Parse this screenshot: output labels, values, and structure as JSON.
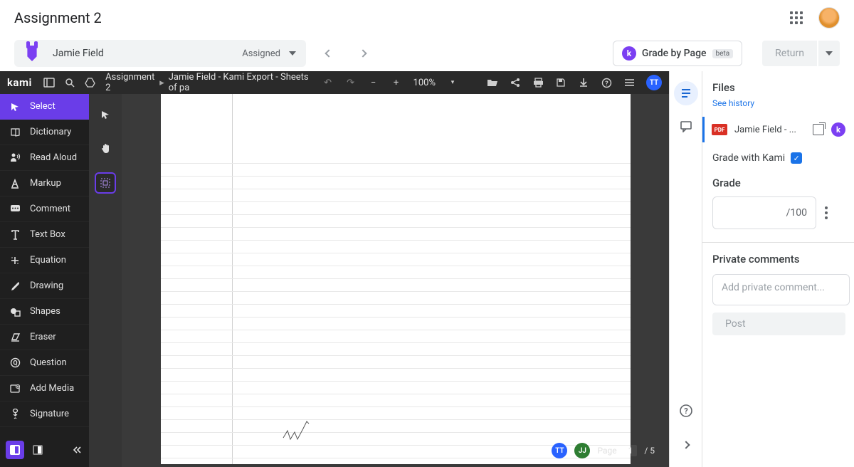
{
  "header": {
    "title": "Assignment 2"
  },
  "student": {
    "name": "Jamie Field",
    "status": "Assigned"
  },
  "actions": {
    "gradeByPage": "Grade by Page",
    "beta": "beta",
    "return": "Return"
  },
  "kami": {
    "logo": "kami",
    "breadcrumb": {
      "root": "Assignment 2",
      "file": "Jamie Field - Kami Export - Sheets of pa"
    },
    "zoom": "100%",
    "userBadge": "TT",
    "tools": {
      "select": "Select",
      "dictionary": "Dictionary",
      "readAloud": "Read Aloud",
      "markup": "Markup",
      "comment": "Comment",
      "textBox": "Text Box",
      "equation": "Equation",
      "drawing": "Drawing",
      "shapes": "Shapes",
      "eraser": "Eraser",
      "question": "Question",
      "addMedia": "Add Media",
      "signature": "Signature"
    },
    "footer": {
      "pageLabel": "Page",
      "pageCurrent": "1",
      "pageTotal": "/ 5",
      "users": {
        "u1": "TT",
        "u2": "JJ"
      }
    }
  },
  "panel": {
    "filesTitle": "Files",
    "seeHistory": "See history",
    "fileName": "Jamie Field - ...",
    "pdf": "PDF",
    "gradeWithKami": "Grade with Kami",
    "gradeTitle": "Grade",
    "gradeTotal": "/100",
    "commentsTitle": "Private comments",
    "commentPlaceholder": "Add private comment...",
    "post": "Post"
  }
}
